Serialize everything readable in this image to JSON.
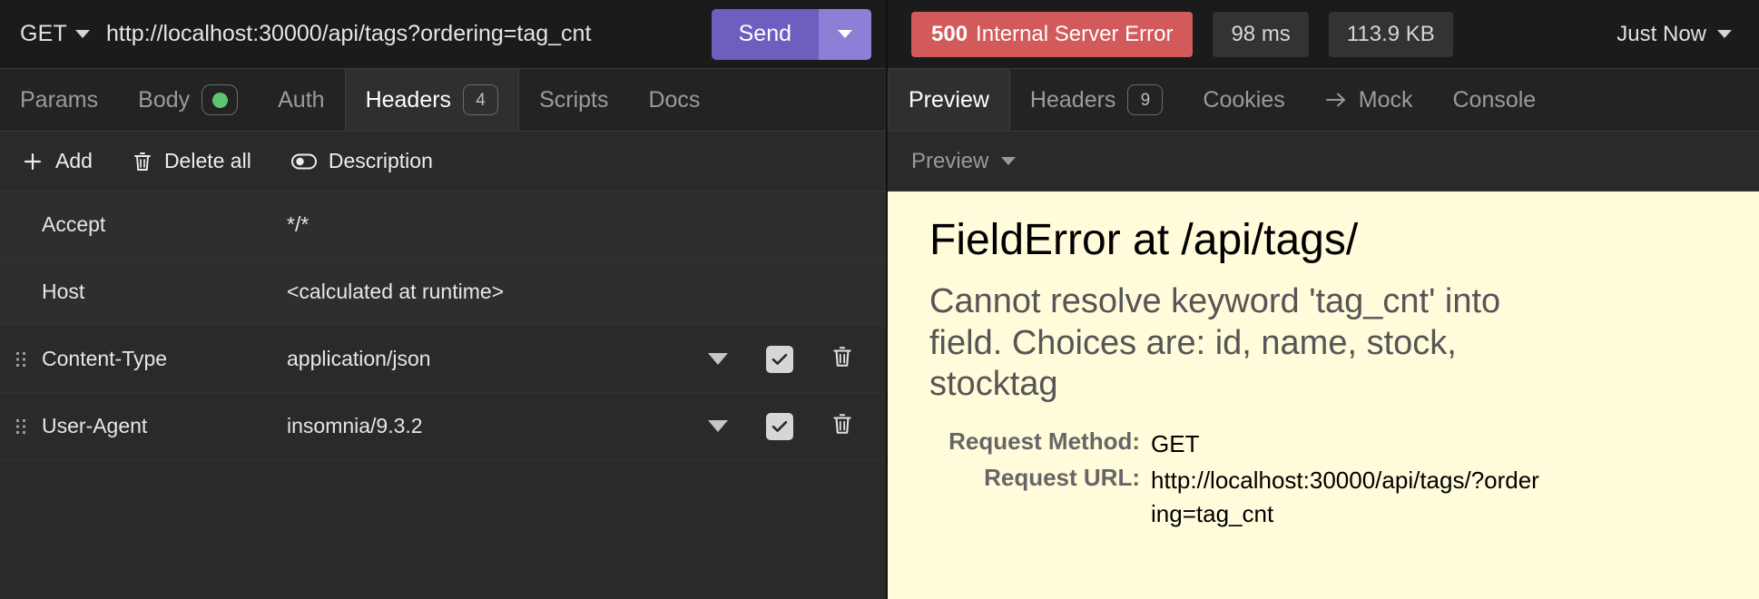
{
  "request": {
    "method": "GET",
    "url": "http://localhost:30000/api/tags?ordering=tag_cnt",
    "send_label": "Send",
    "tabs": [
      {
        "label": "Params",
        "badge": null,
        "active": false
      },
      {
        "label": "Body",
        "badge": "dot",
        "active": false
      },
      {
        "label": "Auth",
        "badge": null,
        "active": false
      },
      {
        "label": "Headers",
        "badge": "4",
        "active": true
      },
      {
        "label": "Scripts",
        "badge": null,
        "active": false
      },
      {
        "label": "Docs",
        "badge": null,
        "active": false
      }
    ],
    "actions": [
      {
        "label": "Add",
        "icon": "plus-icon"
      },
      {
        "label": "Delete all",
        "icon": "trash-icon"
      },
      {
        "label": "Description",
        "icon": "toggle-icon"
      }
    ],
    "headers": [
      {
        "name": "Accept",
        "value": "*/*",
        "editable": false,
        "enabled": true
      },
      {
        "name": "Host",
        "value": "<calculated at runtime>",
        "editable": false,
        "enabled": true
      },
      {
        "name": "Content-Type",
        "value": "application/json",
        "editable": true,
        "enabled": true
      },
      {
        "name": "User-Agent",
        "value": "insomnia/9.3.2",
        "editable": true,
        "enabled": true
      }
    ]
  },
  "response": {
    "status_code": "500",
    "status_text": "Internal Server Error",
    "time": "98 ms",
    "size": "113.9 KB",
    "timestamp": "Just Now",
    "tabs": [
      {
        "label": "Preview",
        "badge": null,
        "active": true,
        "arrow": false
      },
      {
        "label": "Headers",
        "badge": "9",
        "active": false,
        "arrow": false
      },
      {
        "label": "Cookies",
        "badge": null,
        "active": false,
        "arrow": false
      },
      {
        "label": "Mock",
        "badge": null,
        "active": false,
        "arrow": true
      },
      {
        "label": "Console",
        "badge": null,
        "active": false,
        "arrow": false
      }
    ],
    "preview_mode": "Preview",
    "error_page": {
      "title": "FieldError at /api/tags/",
      "message": "Cannot resolve keyword 'tag_cnt' into field. Choices are: id, name, stock, stocktag",
      "rows": [
        {
          "label": "Request Method:",
          "value": "GET"
        },
        {
          "label": "Request URL:",
          "value": "http://localhost:30000/api/tags/?ordering=tag_cnt"
        }
      ]
    }
  },
  "colors": {
    "accent": "#6d5ec0",
    "error": "#d25a5a",
    "ok_dot": "#5ec46f",
    "preview_bg": "#fffbdb"
  }
}
